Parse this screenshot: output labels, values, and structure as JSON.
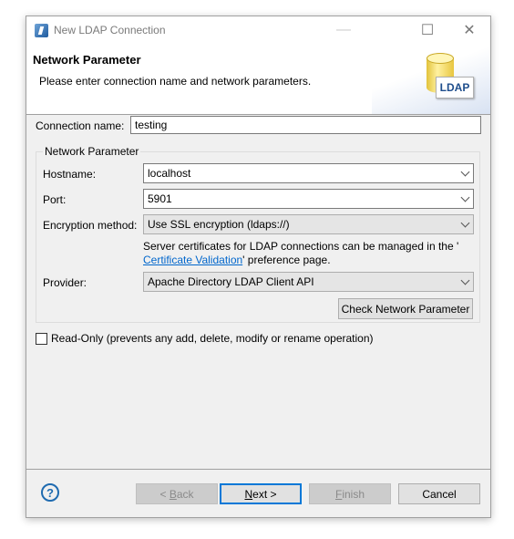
{
  "window": {
    "title": "New LDAP Connection",
    "minimize_glyph": "—",
    "maximize_glyph": "☐",
    "close_glyph": "✕"
  },
  "header": {
    "title": "Network Parameter",
    "description": "Please enter connection name and network parameters.",
    "logo_text": "LDAP"
  },
  "form": {
    "connection_name_label": "Connection name:",
    "connection_name_value": "testing",
    "group_label": "Network Parameter",
    "hostname_label": "Hostname:",
    "hostname_value": "localhost",
    "port_label": "Port:",
    "port_value": "5901",
    "encryption_label": "Encryption method:",
    "encryption_value": "Use SSL encryption (ldaps://)",
    "cert_text_1": "Server certificates for LDAP connections can be managed in the '",
    "cert_link": "Certificate Validation",
    "cert_text_2": "' preference page.",
    "provider_label": "Provider:",
    "provider_value": "Apache Directory LDAP Client API",
    "check_button": "Check Network Parameter",
    "readonly_label": "Read-Only (prevents any add, delete, modify or rename operation)",
    "readonly_checked": false
  },
  "footer": {
    "help_glyph": "?",
    "back_prefix": "< ",
    "back_mnemonic": "B",
    "back_rest": "ack",
    "next_mnemonic": "N",
    "next_rest": "ext >",
    "finish_mnemonic": "F",
    "finish_rest": "inish",
    "cancel": "Cancel"
  }
}
